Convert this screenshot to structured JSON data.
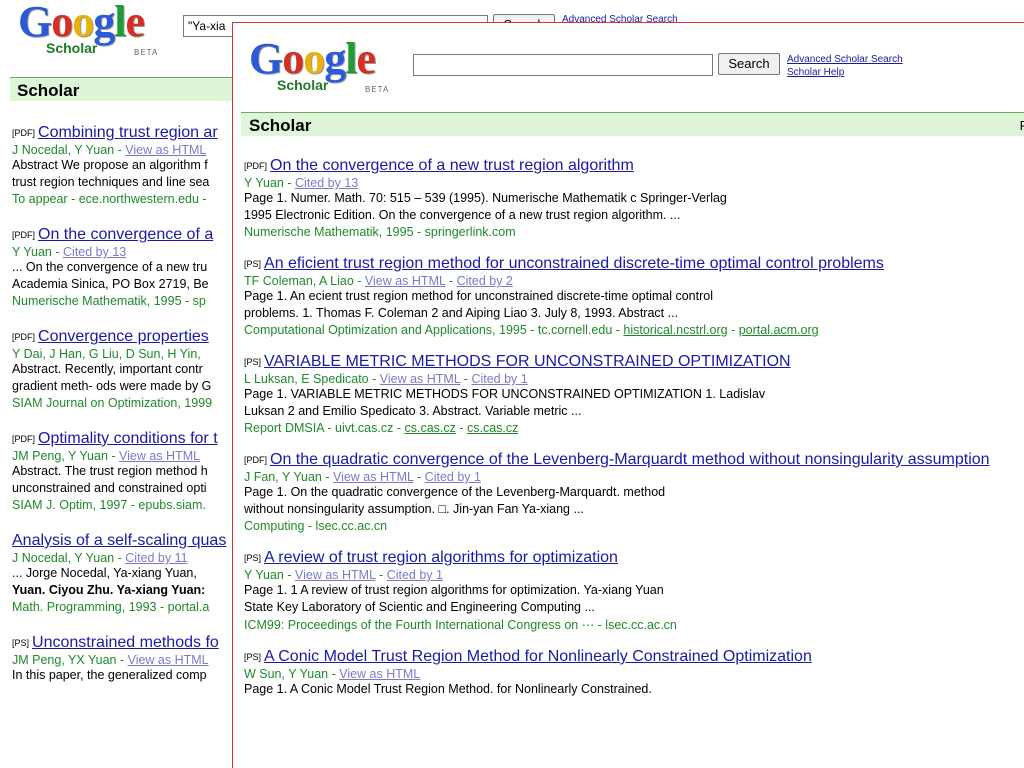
{
  "back": {
    "logo": {
      "word": [
        "G",
        "o",
        "o",
        "g",
        "l",
        "e"
      ],
      "sub": "Scholar",
      "beta": "BETA"
    },
    "search_value": "\"Ya-xia",
    "search_button": "Search",
    "adv_link": "Advanced Scholar Search",
    "bar_label": "Scholar",
    "results": [
      {
        "tag": "[PDF]",
        "title": "Combining trust region ar",
        "authors": "J Nocedal, Y Yuan",
        "links": [
          "View as HTML"
        ],
        "snip": [
          "Abstract We propose an algorithm f",
          "trust region techniques and line sea"
        ],
        "src": "To appear - ece.northwestern.edu -"
      },
      {
        "tag": "[PDF]",
        "title": "On the convergence of a",
        "authors": "Y Yuan",
        "links": [
          "Cited by 13"
        ],
        "snip": [
          "... On the convergence of a new tru",
          "Academia Sinica, PO Box 2719, Be"
        ],
        "src": "Numerische Mathematik, 1995 - sp"
      },
      {
        "tag": "[PDF]",
        "title": "Convergence properties",
        "authors": "Y Dai, J Han, G Liu, D Sun, H Yin,",
        "links": [],
        "snip": [
          "Abstract. Recently, important contr",
          "gradient meth- ods were made by G"
        ],
        "src": "SIAM Journal on Optimization, 1999"
      },
      {
        "tag": "[PDF]",
        "title": "Optimality conditions for t",
        "authors": "JM Peng, Y Yuan",
        "links": [
          "View as HTML"
        ],
        "snip": [
          "Abstract. The trust region method h",
          "unconstrained and constrained opti"
        ],
        "src": "SIAM J. Optim, 1997 - epubs.siam."
      },
      {
        "tag": "",
        "title": "Analysis of a self-scaling quas",
        "authors": "J Nocedal, Y Yuan",
        "links": [
          "Cited by 11"
        ],
        "snip": [
          "... Jorge Nocedal, Ya-xiang Yuan,",
          "Yuan. Ciyou Zhu. Ya-xiang Yuan:"
        ],
        "src": "Math. Programming, 1993 - portal.a"
      },
      {
        "tag": "[PS]",
        "title": "Unconstrained methods fo",
        "authors": "JM Peng, YX Yuan",
        "links": [
          "View as HTML"
        ],
        "snip": [
          "In this paper, the generalized comp"
        ],
        "src": ""
      }
    ]
  },
  "front": {
    "logo": {
      "word": [
        "G",
        "o",
        "o",
        "g",
        "l",
        "e"
      ],
      "sub": "Scholar",
      "beta": "BETA"
    },
    "search_value": "",
    "search_button": "Search",
    "adv_link": "Advanced Scholar Search",
    "help_link": "Scholar Help",
    "bar_label": "Scholar",
    "bar_right": "R",
    "results": [
      {
        "tag": "[PDF]",
        "title": "On the convergence of a new trust region algorithm",
        "authors": "Y Yuan",
        "links": [
          "Cited by 13"
        ],
        "snip": [
          "Page 1. Numer. Math. 70: 515 – 539 (1995). Numerische Mathematik c Springer-Verlag",
          "1995 Electronic Edition. On the convergence of a new trust region algorithm. ..."
        ],
        "src": "Numerische Mathematik, 1995 - springerlink.com",
        "src_links": []
      },
      {
        "tag": "[PS]",
        "title": "An eficient trust region method for unconstrained discrete-time optimal control problems",
        "authors": "TF Coleman, A Liao",
        "links": [
          "View as HTML",
          "Cited by 2"
        ],
        "snip": [
          "Page 1. An ecient trust region method for unconstrained discrete-time optimal control",
          "problems. 1. Thomas F. Coleman 2 and Aiping Liao 3. July 8, 1993. Abstract ..."
        ],
        "src": "Computational Optimization and Applications, 1995 - tc.cornell.edu",
        "src_links": [
          "historical.ncstrl.org",
          "portal.acm.org"
        ]
      },
      {
        "tag": "[PS]",
        "title": "VARIABLE METRIC METHODS FOR UNCONSTRAINED OPTIMIZATION",
        "authors": "L Luksan, E Spedicato",
        "links": [
          "View as HTML",
          "Cited by 1"
        ],
        "snip": [
          "Page 1. VARIABLE METRIC METHODS FOR UNCONSTRAINED OPTIMIZATION 1. Ladislav",
          "Luksan 2 and Emilio Spedicato 3. Abstract. Variable metric ..."
        ],
        "src": "Report DMSIA - uivt.cas.cz",
        "src_links": [
          "cs.cas.cz",
          "cs.cas.cz"
        ]
      },
      {
        "tag": "[PDF]",
        "title": "On the quadratic convergence of the Levenberg-Marquardt method without nonsingularity assumption",
        "authors": "J Fan, Y Yuan",
        "links": [
          "View as HTML",
          "Cited by 1"
        ],
        "snip": [
          "Page 1. On the quadratic convergence of the Levenberg-Marquardt. method",
          "without nonsingularity assumption. □. Jin-yan Fan Ya-xiang ..."
        ],
        "src": "Computing - lsec.cc.ac.cn",
        "src_links": []
      },
      {
        "tag": "[PS]",
        "title": "A review of trust region algorithms for optimization",
        "authors": "Y Yuan",
        "links": [
          "View as HTML",
          "Cited by 1"
        ],
        "snip": [
          "Page 1. 1 A review of trust region algorithms for optimization. Ya-xiang Yuan",
          "State Key Laboratory of Scientic and Engineering Computing ..."
        ],
        "src": "ICM99: Proceedings of the Fourth International Congress on ⋯ - lsec.cc.ac.cn",
        "src_links": []
      },
      {
        "tag": "[PS]",
        "title": "A Conic Model Trust Region Method for Nonlinearly Constrained Optimization",
        "authors": "W Sun, Y Yuan",
        "links": [
          "View as HTML"
        ],
        "snip": [
          "Page 1. A Conic Model Trust Region Method. for Nonlinearly Constrained."
        ],
        "src": "",
        "src_links": []
      }
    ]
  }
}
